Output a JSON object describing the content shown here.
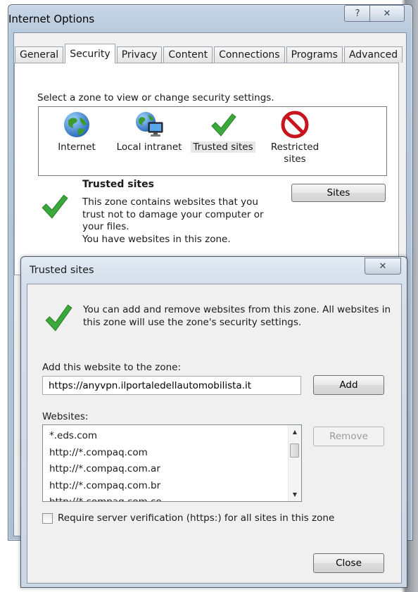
{
  "main_window": {
    "title": "Internet Options",
    "help_glyph": "?",
    "close_glyph": "✕",
    "tabs": [
      {
        "label": "General"
      },
      {
        "label": "Security",
        "active": true
      },
      {
        "label": "Privacy"
      },
      {
        "label": "Content"
      },
      {
        "label": "Connections"
      },
      {
        "label": "Programs"
      },
      {
        "label": "Advanced"
      }
    ],
    "security": {
      "prompt": "Select a zone to view or change security settings.",
      "zones": [
        {
          "label": "Internet",
          "icon": "globe-icon"
        },
        {
          "label": "Local intranet",
          "icon": "intranet-icon"
        },
        {
          "label": "Trusted sites",
          "icon": "checkmark-icon",
          "selected": true
        },
        {
          "label": "Restricted sites",
          "icon": "restricted-icon"
        }
      ],
      "zone_title": "Trusted sites",
      "zone_desc": "This zone contains websites that you trust not to damage your computer or your files.",
      "zone_status": "You have websites in this zone.",
      "sites_button": "Sites"
    }
  },
  "dialog": {
    "title": "Trusted sites",
    "close_glyph": "✕",
    "info": "You can add and remove websites from this zone. All websites in this zone will use the zone's security settings.",
    "add_label": "Add this website to the zone:",
    "url_value": "https://anyvpn.ilportaledellautomobilista.it",
    "add_button": "Add",
    "websites_label": "Websites:",
    "websites": [
      "*.eds.com",
      "http://*.compaq.com",
      "http://*.compaq.com.ar",
      "http://*.compaq.com.br",
      "http://*.compaq.com.co"
    ],
    "remove_button": "Remove",
    "require_https_label": "Require server verification (https:) for all sites in this zone",
    "require_https_checked": false,
    "close_button": "Close"
  },
  "colors": {
    "check_green": "#3aa83a",
    "restricted_red": "#c8141c",
    "globe_blue": "#2a78c8"
  }
}
